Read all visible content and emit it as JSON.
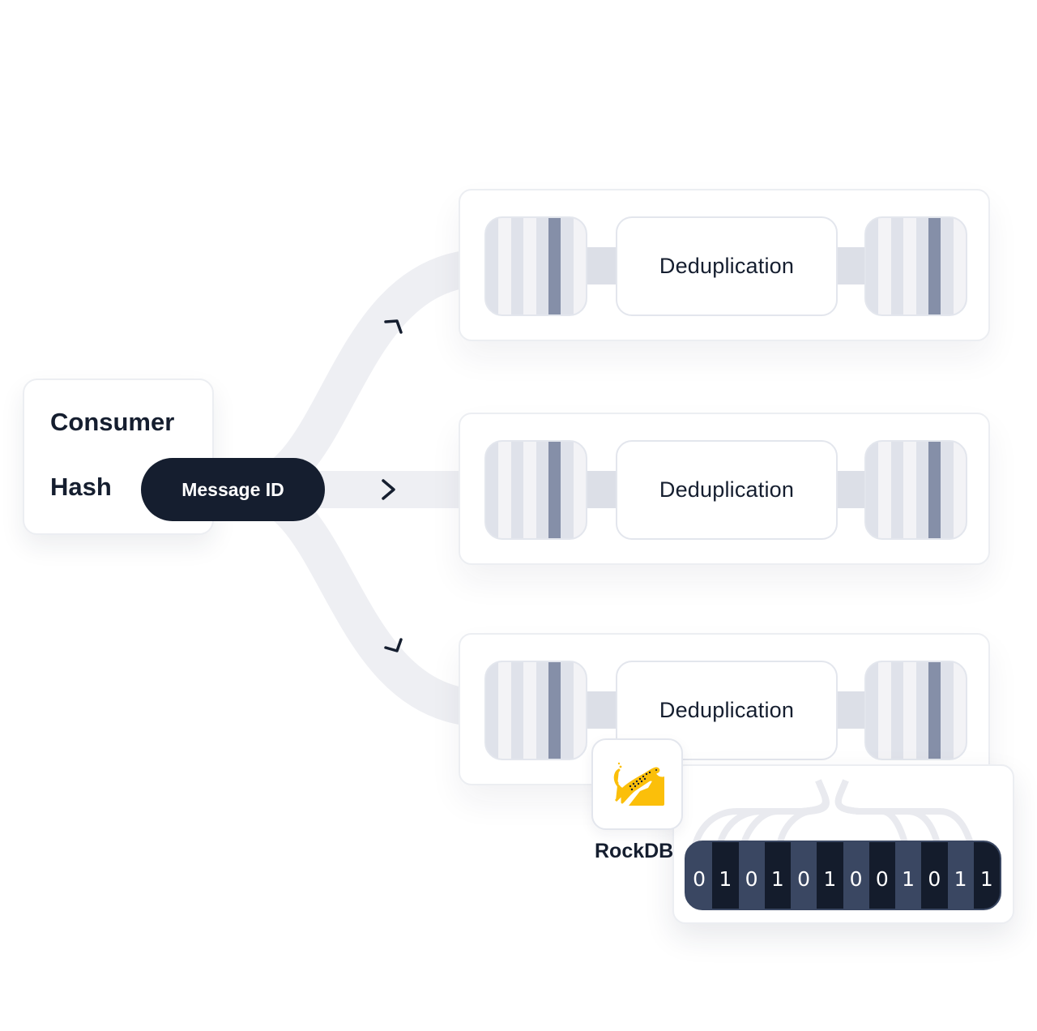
{
  "consumer": {
    "title": "Consumer",
    "hash_label": "Hash",
    "message_id_label": "Message ID"
  },
  "flow_arrows": [
    "chevron-up-right",
    "chevron-right",
    "chevron-down-right"
  ],
  "rows": [
    {
      "label": "Deduplication"
    },
    {
      "label": "Deduplication"
    },
    {
      "label": "Deduplication"
    }
  ],
  "queue_stripes": [
    "mid",
    "light",
    "mid",
    "light",
    "mid",
    "dark",
    "mid",
    "light"
  ],
  "storage": {
    "label": "RockDB",
    "icon": "leopard-icon",
    "icon_color": "#fbbf0a"
  },
  "bitmap": {
    "bits": [
      "0",
      "1",
      "0",
      "1",
      "0",
      "1",
      "0",
      "0",
      "1",
      "0",
      "1",
      "1"
    ]
  },
  "colors": {
    "ink": "#151e2f",
    "flow": "#eeeff3",
    "queue_dark": "#858fa8",
    "bar": "#3a4762",
    "bar_dark": "#141c2c"
  }
}
